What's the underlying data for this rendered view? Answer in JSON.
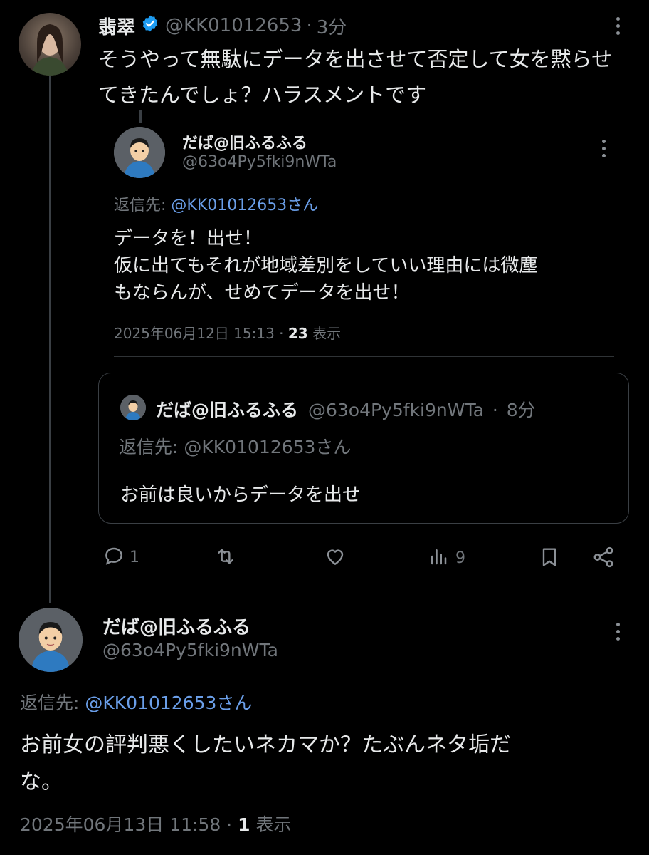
{
  "top_tweet": {
    "display_name": "翡翠",
    "handle": "@KK01012653",
    "separator": "·",
    "time": "3分",
    "text_line1": "そうやって無駄にデータを出させて否定して女を黙らせ",
    "text_line2": "てきたんでしょ？ハラスメントです"
  },
  "quoted_reply": {
    "display_name": "だば@旧ふるふる",
    "handle": "@63o4Py5fki9nWTa",
    "reply_to_label": "返信先: ",
    "reply_to_handle": "@KK01012653さん",
    "text_line1": "データを！出せ！",
    "text_line2": "仮に出てもそれが地域差別をしていい理由には微塵",
    "text_line3": "もならんが、せめてデータを出せ！",
    "timestamp": "2025年06月12日 15:13 · ",
    "views_count": "23",
    "views_label": " 表示"
  },
  "quote_card": {
    "display_name": "だば@旧ふるふる",
    "handle": "@63o4Py5fki9nWTa",
    "separator": "·",
    "time": "8分",
    "reply_to_label": "返信先: ",
    "reply_to_handle": "@KK01012653さん",
    "text": "お前は良いからデータを出せ"
  },
  "actions": {
    "reply_count": "1",
    "views_count": "9"
  },
  "bottom_tweet": {
    "display_name": "だば@旧ふるふる",
    "handle": "@63o4Py5fki9nWTa",
    "reply_to_label": "返信先: ",
    "reply_to_handle": "@KK01012653さん",
    "text_line1": "お前女の評判悪くしたいネカマか？たぶんネタ垢だ",
    "text_line2": "な。",
    "timestamp": "2025年06月13日 11:58 · ",
    "views_count": "1",
    "views_label": " 表示"
  },
  "colors": {
    "background": "#000000",
    "text": "#e7e9ea",
    "secondary": "#71767b",
    "link": "#6a9ee8",
    "verified": "#1d9bf0"
  },
  "icons": [
    "verified-badge-icon",
    "more-icon",
    "reply-icon",
    "retweet-icon",
    "like-icon",
    "views-icon",
    "bookmark-icon",
    "share-icon"
  ]
}
